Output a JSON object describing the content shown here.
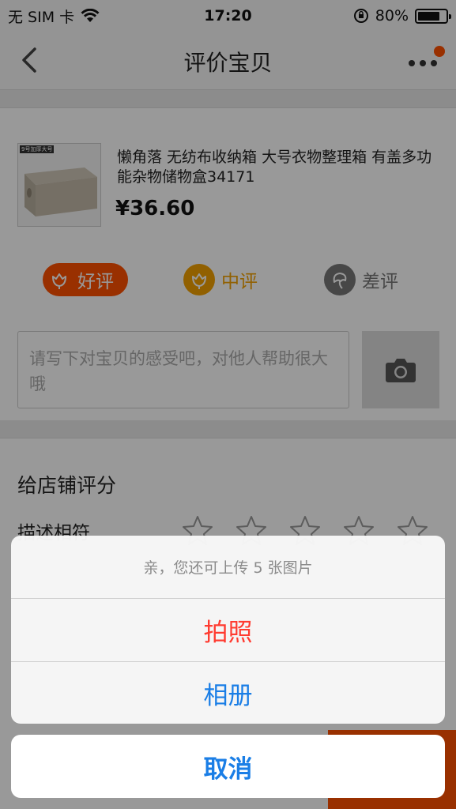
{
  "status_bar": {
    "carrier": "无 SIM 卡",
    "time": "17:20",
    "battery": "80%",
    "battery_level": 0.8
  },
  "nav": {
    "title": "评价宝贝"
  },
  "product": {
    "image_tag": "9号加厚大号",
    "title": "懒角落 无纺布收纳箱 大号衣物整理箱 有盖多功能杂物储物盒34171",
    "price": "¥36.60"
  },
  "ratings": {
    "good": "好评",
    "mid": "中评",
    "bad": "差评"
  },
  "comment": {
    "placeholder": "请写下对宝贝的感受吧，对他人帮助很大哦"
  },
  "shop": {
    "title": "给店铺评分",
    "row_label": "描述相符"
  },
  "action_sheet": {
    "message": "亲，您还可上传 5 张图片",
    "take_photo": "拍照",
    "album": "相册",
    "cancel": "取消"
  },
  "colors": {
    "accent": "#ff5000",
    "mid": "#f2a100",
    "ios_blue": "#1a7ee6",
    "ios_red": "#ff3b30"
  }
}
